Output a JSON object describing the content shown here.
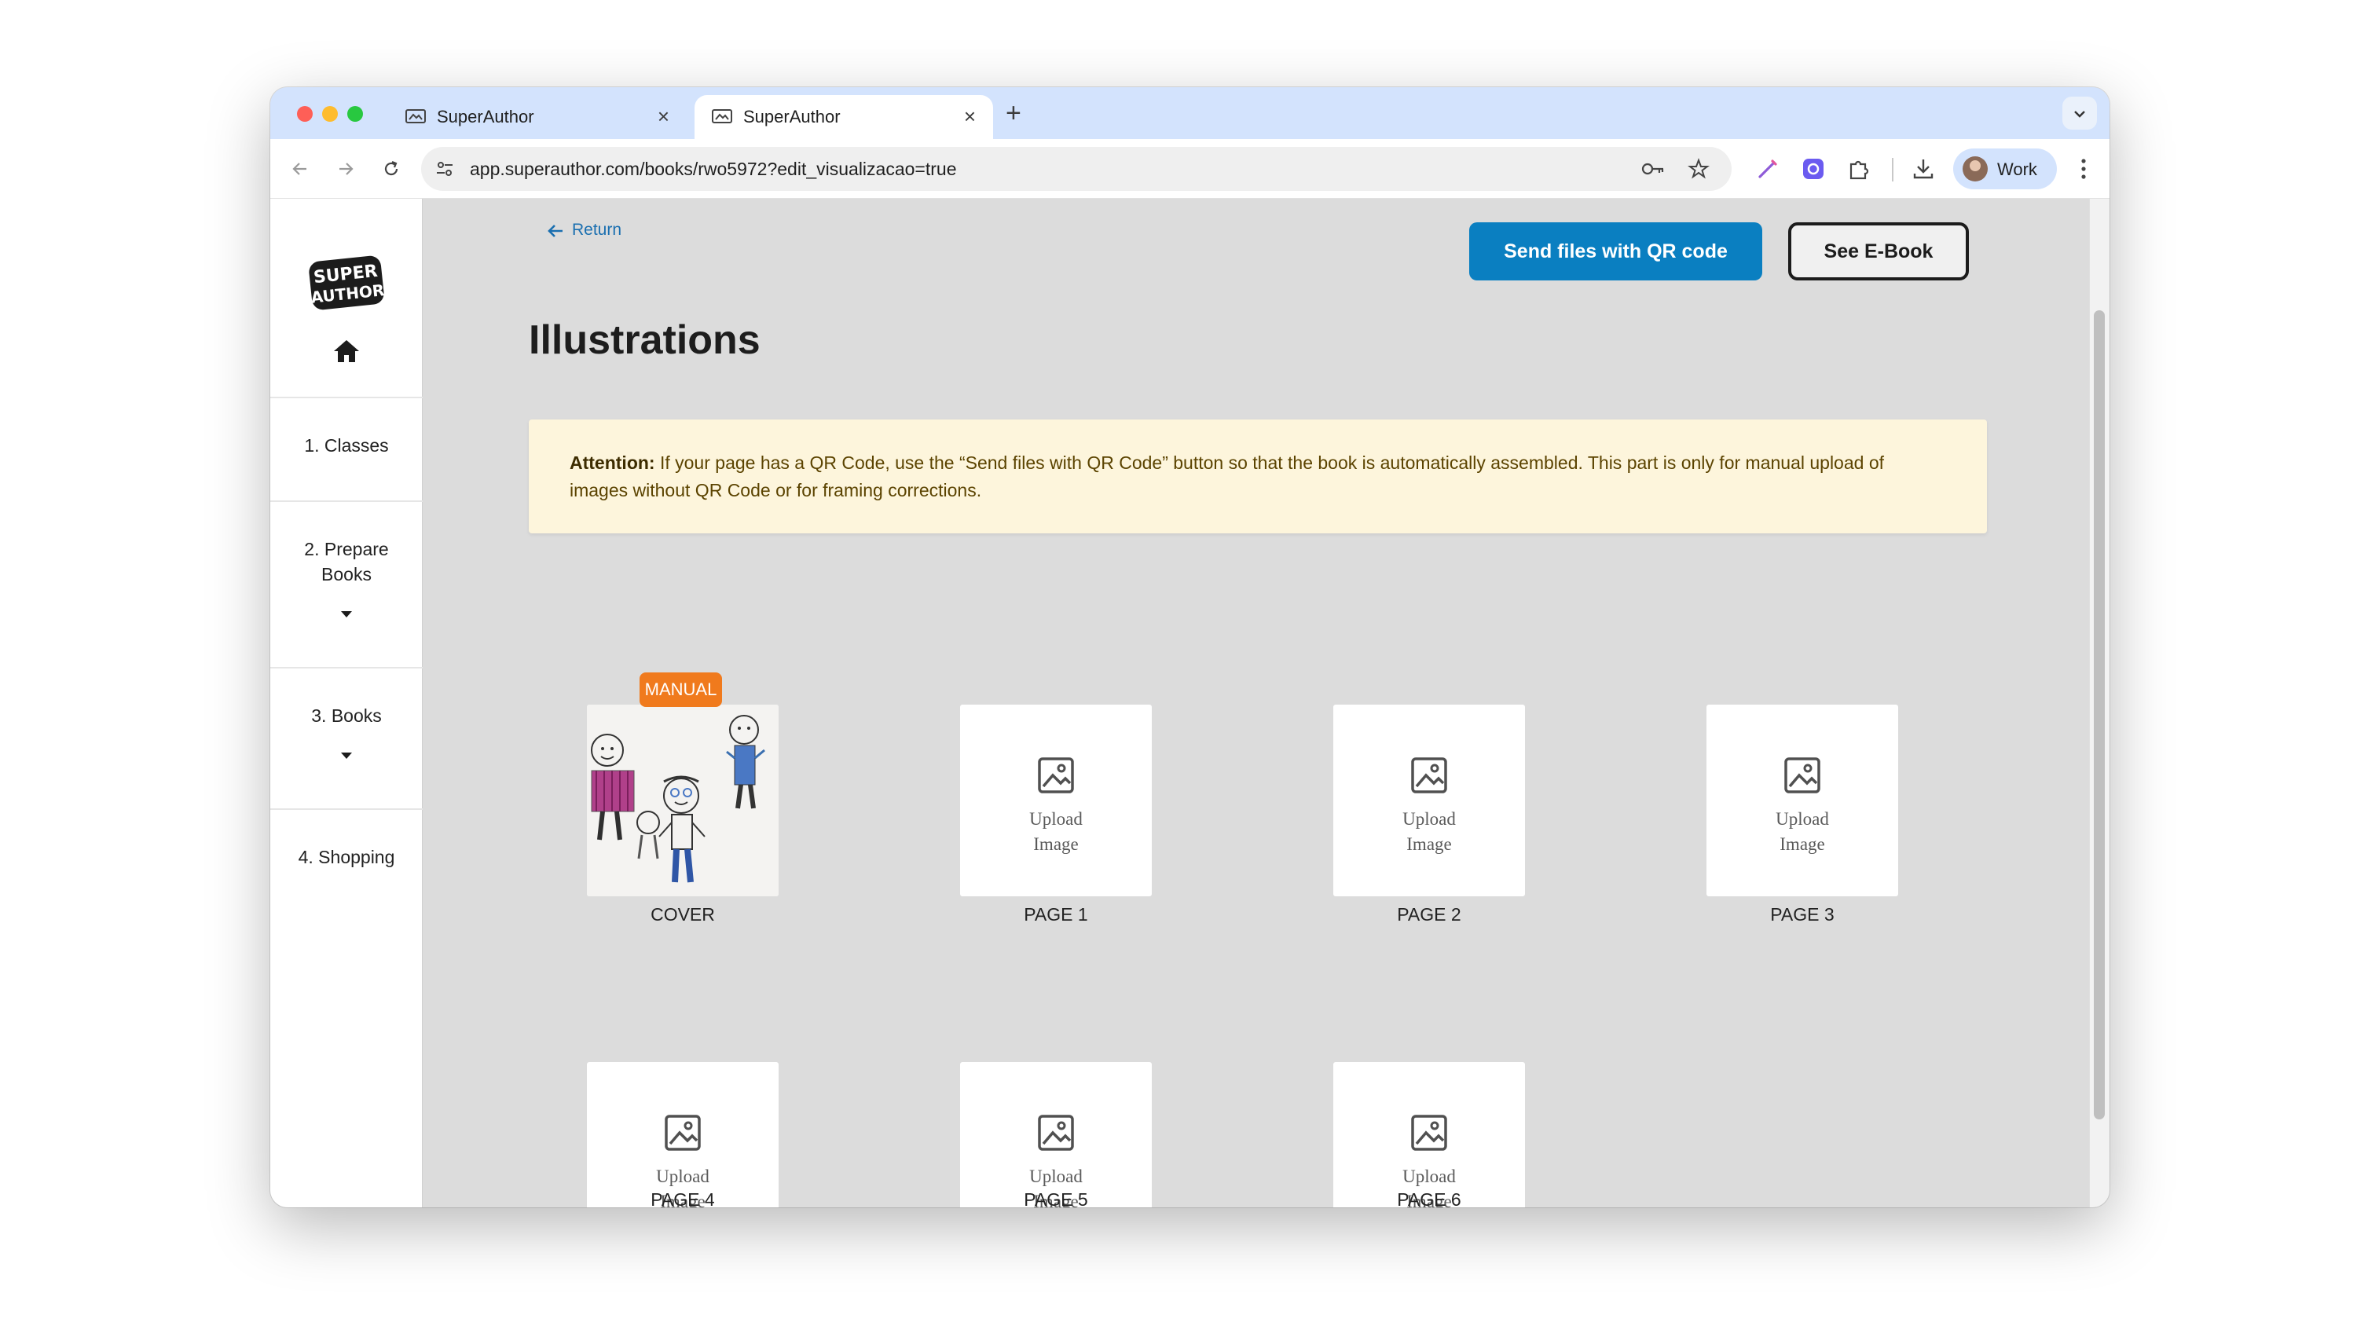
{
  "browser": {
    "tabs": [
      {
        "title": "SuperAuthor",
        "active": false
      },
      {
        "title": "SuperAuthor",
        "active": true
      }
    ],
    "new_tab_symbol": "+",
    "close_symbol": "×",
    "url": "app.superauthor.com/books/rwo5972?edit_visualizacao=true",
    "profile_label": "Work",
    "icons": [
      "back-icon",
      "forward-icon",
      "reload-icon",
      "site-info-icon",
      "key-icon",
      "star-icon",
      "pen-extension-icon",
      "box-extension-icon",
      "puzzle-icon",
      "download-icon",
      "more-vert-icon",
      "chevron-down-icon"
    ]
  },
  "sidebar": {
    "logo_text": "SUPER AUTHOR",
    "items": [
      {
        "label": "1. Classes",
        "has_caret": false
      },
      {
        "label": "2. Prepare\nBooks",
        "has_caret": true
      },
      {
        "label": "3. Books",
        "has_caret": true
      },
      {
        "label": "4. Shopping",
        "has_caret": false
      }
    ]
  },
  "main": {
    "return_label": "Return",
    "send_qr_label": "Send files with QR code",
    "see_ebook_label": "See E-Book",
    "title": "Illustrations",
    "attention_label": "Attention:",
    "attention_text": "If your page has a QR Code, use the “Send files with QR Code” button so that the book is automatically assembled. This part is only for manual upload of images without QR Code or for framing corrections.",
    "manual_badge": "MANUAL",
    "upload_line1": "Upload",
    "upload_line2": "Image",
    "pages": [
      {
        "label": "COVER",
        "has_image": true
      },
      {
        "label": "PAGE 1",
        "has_image": false
      },
      {
        "label": "PAGE 2",
        "has_image": false
      },
      {
        "label": "PAGE 3",
        "has_image": false
      },
      {
        "label": "PAGE 4",
        "has_image": false
      },
      {
        "label": "PAGE 5",
        "has_image": false
      },
      {
        "label": "PAGE 6",
        "has_image": false
      }
    ]
  },
  "colors": {
    "primary_button": "#0a7fc1",
    "manual_badge": "#f07a1d",
    "attention_bg": "#fdf5dc",
    "content_bg": "#dcdcdc",
    "link": "#1a6fb0"
  }
}
